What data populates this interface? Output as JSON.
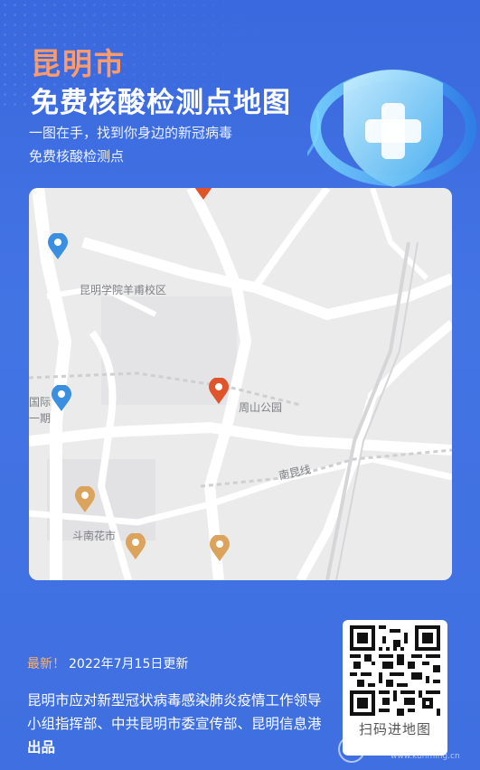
{
  "header": {
    "city": "昆明市",
    "title": "免费核酸检测点地图",
    "subtitle_line1": "一图在手，找到你身边的新冠病毒",
    "subtitle_line2": "免费核酸检测点"
  },
  "map": {
    "labels": {
      "campus": "昆明学院羊甫校区",
      "park": "周山公园",
      "market": "斗南花市",
      "road": "南昆线",
      "edge1": "国际",
      "edge2": "一期"
    }
  },
  "footer": {
    "update_prefix": "最新！",
    "update_date": "2022年7月15日更新",
    "credit_text": "昆明市应对新型冠状病毒感染肺炎疫情工作领导小组指挥部、中共昆明市委宣传部、昆明信息港",
    "credit_suffix": "出品",
    "qr_label": "扫码进地图",
    "watermark_text": "信息港",
    "watermark_url": "www.kunming.cn"
  },
  "colors": {
    "background": "#3f6fe0",
    "accent_orange": "#ff9b6a",
    "pin_blue": "#3b8fe0",
    "pin_red": "#e0542c",
    "pin_tan": "#dca35c"
  },
  "icons": [
    "medical-cross-icon",
    "map-pin-icon",
    "qr-code-icon"
  ]
}
